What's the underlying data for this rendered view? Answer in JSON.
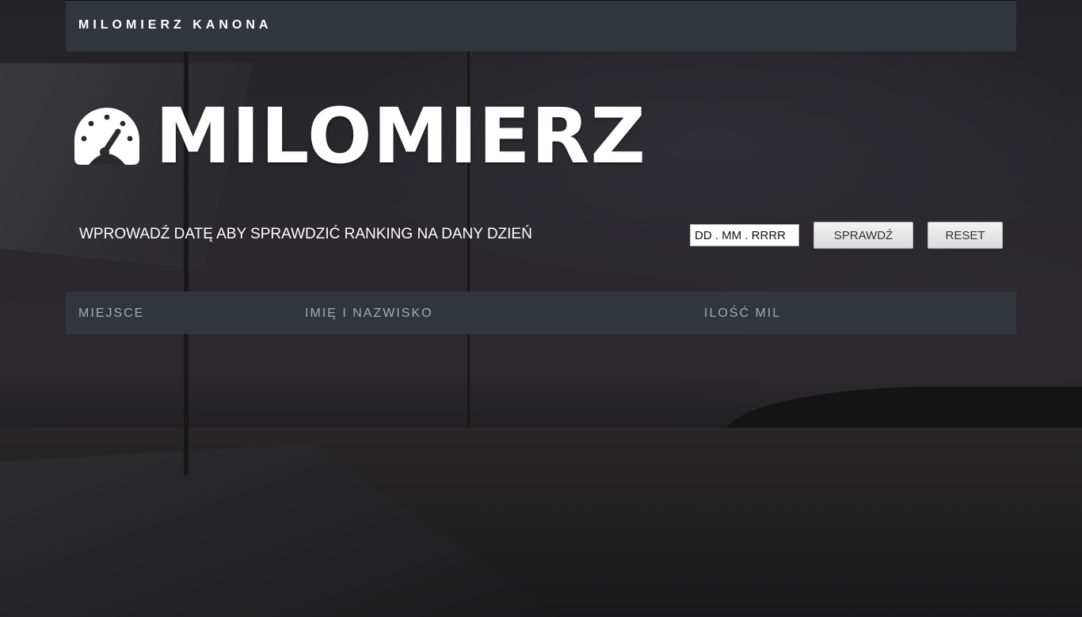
{
  "navbar": {
    "brand": "MILOMIERZ KANONA"
  },
  "hero": {
    "icon": "gauge-icon",
    "title": "MILOMIERZ"
  },
  "date_form": {
    "prompt": "WPROWADŹ DATĘ ABY SPRAWDZIĆ RANKING NA DANY DZIEŃ",
    "date_placeholder": "DD . MM . RRRR",
    "check_label": "SPRAWDŹ",
    "reset_label": "RESET"
  },
  "ranking_table": {
    "columns": [
      "MIEJSCE",
      "IMIĘ I NAZWISKO",
      "ILOŚĆ MIL"
    ],
    "rows": []
  },
  "colors": {
    "bar_background": "#31353c",
    "header_text": "#a7abb1",
    "text": "#ffffff"
  }
}
